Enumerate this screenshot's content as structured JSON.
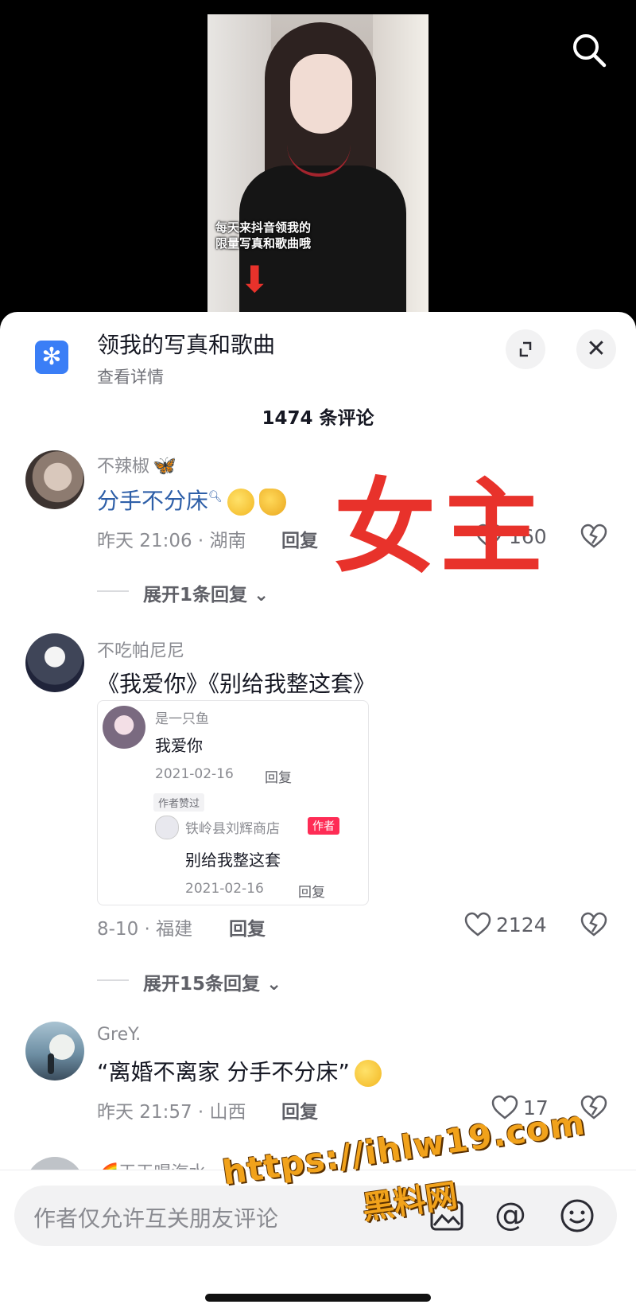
{
  "video": {
    "caption_line1": "每天来抖音领我的",
    "caption_line2": "限量写真和歌曲哦"
  },
  "tool": {
    "title": "领我的写真和歌曲",
    "subtitle": "查看详情"
  },
  "comments_count": "1474 条评论",
  "comments": [
    {
      "user": "不辣椒",
      "text": "分手不分床",
      "meta": "昨天 21:06 · 湖南",
      "reply": "回复",
      "likes": "160",
      "expand": "展开1条回复"
    },
    {
      "user": "不吃帕尼尼",
      "text": "《我爱你》《别给我整这套》",
      "meta": "8-10 · 福建",
      "reply": "回复",
      "likes": "2124",
      "expand": "展开15条回复"
    },
    {
      "user": "GreY.",
      "text": "“离婚不离家 分手不分床”",
      "meta": "昨天 21:57 · 山西",
      "reply": "回复",
      "likes": "17"
    },
    {
      "user": "天天喝汽水"
    }
  ],
  "quote": {
    "user": "是一只鱼",
    "text": "我爱你",
    "date": "2021-02-16",
    "reply": "回复",
    "badge": "作者赞过",
    "reply_user": "铁岭县刘辉商店",
    "author_tag": "作者",
    "reply_text": "别给我整这套",
    "reply_date": "2021-02-16",
    "reply_reply": "回复"
  },
  "overlay_text": "女主",
  "input": {
    "placeholder": "作者仅允许互关朋友评论"
  },
  "watermark": {
    "line1": "https://ihlw19.com",
    "line2": "黑料网"
  },
  "colors": {
    "accent": "#fe2c55",
    "link": "#2e5fa8",
    "overlay": "#e8322b"
  }
}
